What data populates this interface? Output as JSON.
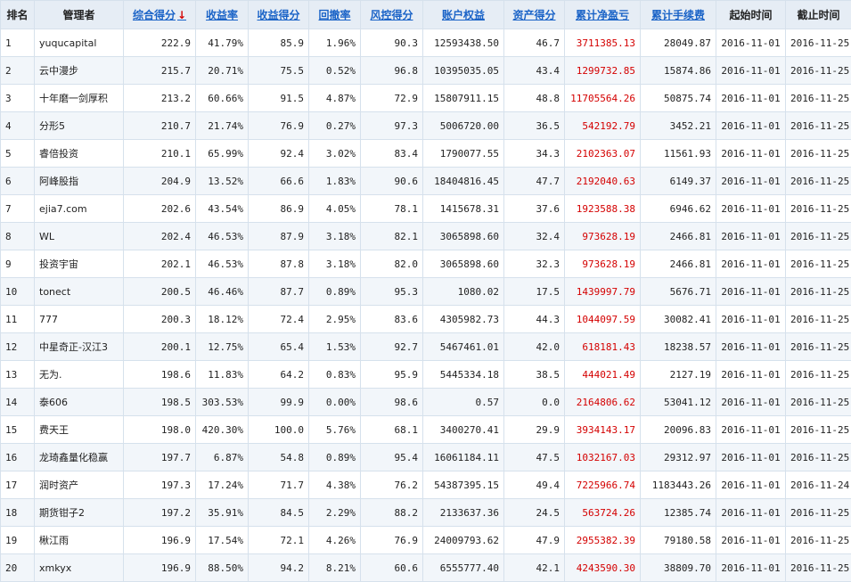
{
  "header": {
    "rank": "排名",
    "manager": "管理者",
    "composite": "综合得分",
    "return_rate": "收益率",
    "return_score": "收益得分",
    "drawdown": "回撤率",
    "risk_score": "风控得分",
    "equity": "账户权益",
    "asset_score": "资产得分",
    "net_pnl": "累计净盈亏",
    "fees": "累计手续费",
    "start": "起始时间",
    "end": "截止时间",
    "sort_arrow": "↓"
  },
  "rows": [
    {
      "rank": "1",
      "manager": "yuqucapital",
      "composite": "222.9",
      "return_rate": "41.79%",
      "return_score": "85.9",
      "drawdown": "1.96%",
      "risk_score": "90.3",
      "equity": "12593438.50",
      "asset_score": "46.7",
      "net_pnl": "3711385.13",
      "fees": "28049.87",
      "start": "2016-11-01",
      "end": "2016-11-25"
    },
    {
      "rank": "2",
      "manager": "云中漫步",
      "composite": "215.7",
      "return_rate": "20.71%",
      "return_score": "75.5",
      "drawdown": "0.52%",
      "risk_score": "96.8",
      "equity": "10395035.05",
      "asset_score": "43.4",
      "net_pnl": "1299732.85",
      "fees": "15874.86",
      "start": "2016-11-01",
      "end": "2016-11-25"
    },
    {
      "rank": "3",
      "manager": "十年磨一剑厚积",
      "composite": "213.2",
      "return_rate": "60.66%",
      "return_score": "91.5",
      "drawdown": "4.87%",
      "risk_score": "72.9",
      "equity": "15807911.15",
      "asset_score": "48.8",
      "net_pnl": "11705564.26",
      "fees": "50875.74",
      "start": "2016-11-01",
      "end": "2016-11-25"
    },
    {
      "rank": "4",
      "manager": "分形5",
      "composite": "210.7",
      "return_rate": "21.74%",
      "return_score": "76.9",
      "drawdown": "0.27%",
      "risk_score": "97.3",
      "equity": "5006720.00",
      "asset_score": "36.5",
      "net_pnl": "542192.79",
      "fees": "3452.21",
      "start": "2016-11-01",
      "end": "2016-11-25"
    },
    {
      "rank": "5",
      "manager": "睿倍投资",
      "composite": "210.1",
      "return_rate": "65.99%",
      "return_score": "92.4",
      "drawdown": "3.02%",
      "risk_score": "83.4",
      "equity": "1790077.55",
      "asset_score": "34.3",
      "net_pnl": "2102363.07",
      "fees": "11561.93",
      "start": "2016-11-01",
      "end": "2016-11-25"
    },
    {
      "rank": "6",
      "manager": "阿峰股指",
      "composite": "204.9",
      "return_rate": "13.52%",
      "return_score": "66.6",
      "drawdown": "1.83%",
      "risk_score": "90.6",
      "equity": "18404816.45",
      "asset_score": "47.7",
      "net_pnl": "2192040.63",
      "fees": "6149.37",
      "start": "2016-11-01",
      "end": "2016-11-25"
    },
    {
      "rank": "7",
      "manager": "ejia7.com",
      "composite": "202.6",
      "return_rate": "43.54%",
      "return_score": "86.9",
      "drawdown": "4.05%",
      "risk_score": "78.1",
      "equity": "1415678.31",
      "asset_score": "37.6",
      "net_pnl": "1923588.38",
      "fees": "6946.62",
      "start": "2016-11-01",
      "end": "2016-11-25"
    },
    {
      "rank": "8",
      "manager": "WL",
      "composite": "202.4",
      "return_rate": "46.53%",
      "return_score": "87.9",
      "drawdown": "3.18%",
      "risk_score": "82.1",
      "equity": "3065898.60",
      "asset_score": "32.4",
      "net_pnl": "973628.19",
      "fees": "2466.81",
      "start": "2016-11-01",
      "end": "2016-11-25"
    },
    {
      "rank": "9",
      "manager": "投资宇宙",
      "composite": "202.1",
      "return_rate": "46.53%",
      "return_score": "87.8",
      "drawdown": "3.18%",
      "risk_score": "82.0",
      "equity": "3065898.60",
      "asset_score": "32.3",
      "net_pnl": "973628.19",
      "fees": "2466.81",
      "start": "2016-11-01",
      "end": "2016-11-25"
    },
    {
      "rank": "10",
      "manager": "tonect",
      "composite": "200.5",
      "return_rate": "46.46%",
      "return_score": "87.7",
      "drawdown": "0.89%",
      "risk_score": "95.3",
      "equity": "1080.02",
      "asset_score": "17.5",
      "net_pnl": "1439997.79",
      "fees": "5676.71",
      "start": "2016-11-01",
      "end": "2016-11-25"
    },
    {
      "rank": "11",
      "manager": "777",
      "composite": "200.3",
      "return_rate": "18.12%",
      "return_score": "72.4",
      "drawdown": "2.95%",
      "risk_score": "83.6",
      "equity": "4305982.73",
      "asset_score": "44.3",
      "net_pnl": "1044097.59",
      "fees": "30082.41",
      "start": "2016-11-01",
      "end": "2016-11-25"
    },
    {
      "rank": "12",
      "manager": "中星奇正-汉江3",
      "composite": "200.1",
      "return_rate": "12.75%",
      "return_score": "65.4",
      "drawdown": "1.53%",
      "risk_score": "92.7",
      "equity": "5467461.01",
      "asset_score": "42.0",
      "net_pnl": "618181.43",
      "fees": "18238.57",
      "start": "2016-11-01",
      "end": "2016-11-25"
    },
    {
      "rank": "13",
      "manager": "无为.",
      "composite": "198.6",
      "return_rate": "11.83%",
      "return_score": "64.2",
      "drawdown": "0.83%",
      "risk_score": "95.9",
      "equity": "5445334.18",
      "asset_score": "38.5",
      "net_pnl": "444021.49",
      "fees": "2127.19",
      "start": "2016-11-01",
      "end": "2016-11-25"
    },
    {
      "rank": "14",
      "manager": "泰606",
      "composite": "198.5",
      "return_rate": "303.53%",
      "return_score": "99.9",
      "drawdown": "0.00%",
      "risk_score": "98.6",
      "equity": "0.57",
      "asset_score": "0.0",
      "net_pnl": "2164806.62",
      "fees": "53041.12",
      "start": "2016-11-01",
      "end": "2016-11-25"
    },
    {
      "rank": "15",
      "manager": "费天王",
      "composite": "198.0",
      "return_rate": "420.30%",
      "return_score": "100.0",
      "drawdown": "5.76%",
      "risk_score": "68.1",
      "equity": "3400270.41",
      "asset_score": "29.9",
      "net_pnl": "3934143.17",
      "fees": "20096.83",
      "start": "2016-11-01",
      "end": "2016-11-25"
    },
    {
      "rank": "16",
      "manager": "龙琦鑫量化稳赢",
      "composite": "197.7",
      "return_rate": "6.87%",
      "return_score": "54.8",
      "drawdown": "0.89%",
      "risk_score": "95.4",
      "equity": "16061184.11",
      "asset_score": "47.5",
      "net_pnl": "1032167.03",
      "fees": "29312.97",
      "start": "2016-11-01",
      "end": "2016-11-25"
    },
    {
      "rank": "17",
      "manager": "润时资产",
      "composite": "197.3",
      "return_rate": "17.24%",
      "return_score": "71.7",
      "drawdown": "4.38%",
      "risk_score": "76.2",
      "equity": "54387395.15",
      "asset_score": "49.4",
      "net_pnl": "7225966.74",
      "fees": "1183443.26",
      "start": "2016-11-01",
      "end": "2016-11-24"
    },
    {
      "rank": "18",
      "manager": "期货钳子2",
      "composite": "197.2",
      "return_rate": "35.91%",
      "return_score": "84.5",
      "drawdown": "2.29%",
      "risk_score": "88.2",
      "equity": "2133637.36",
      "asset_score": "24.5",
      "net_pnl": "563724.26",
      "fees": "12385.74",
      "start": "2016-11-01",
      "end": "2016-11-25"
    },
    {
      "rank": "19",
      "manager": "楸江雨",
      "composite": "196.9",
      "return_rate": "17.54%",
      "return_score": "72.1",
      "drawdown": "4.26%",
      "risk_score": "76.9",
      "equity": "24009793.62",
      "asset_score": "47.9",
      "net_pnl": "2955382.39",
      "fees": "79180.58",
      "start": "2016-11-01",
      "end": "2016-11-25"
    },
    {
      "rank": "20",
      "manager": "xmkyx",
      "composite": "196.9",
      "return_rate": "88.50%",
      "return_score": "94.2",
      "drawdown": "8.21%",
      "risk_score": "60.6",
      "equity": "6555777.40",
      "asset_score": "42.1",
      "net_pnl": "4243590.30",
      "fees": "38809.70",
      "start": "2016-11-01",
      "end": "2016-11-25"
    }
  ],
  "colors": {
    "header_bg": "#e6edf5",
    "link": "#1a63c7",
    "pnl_red": "#d40000",
    "row_alt": "#f2f6fa",
    "border": "#d6e1ec"
  }
}
